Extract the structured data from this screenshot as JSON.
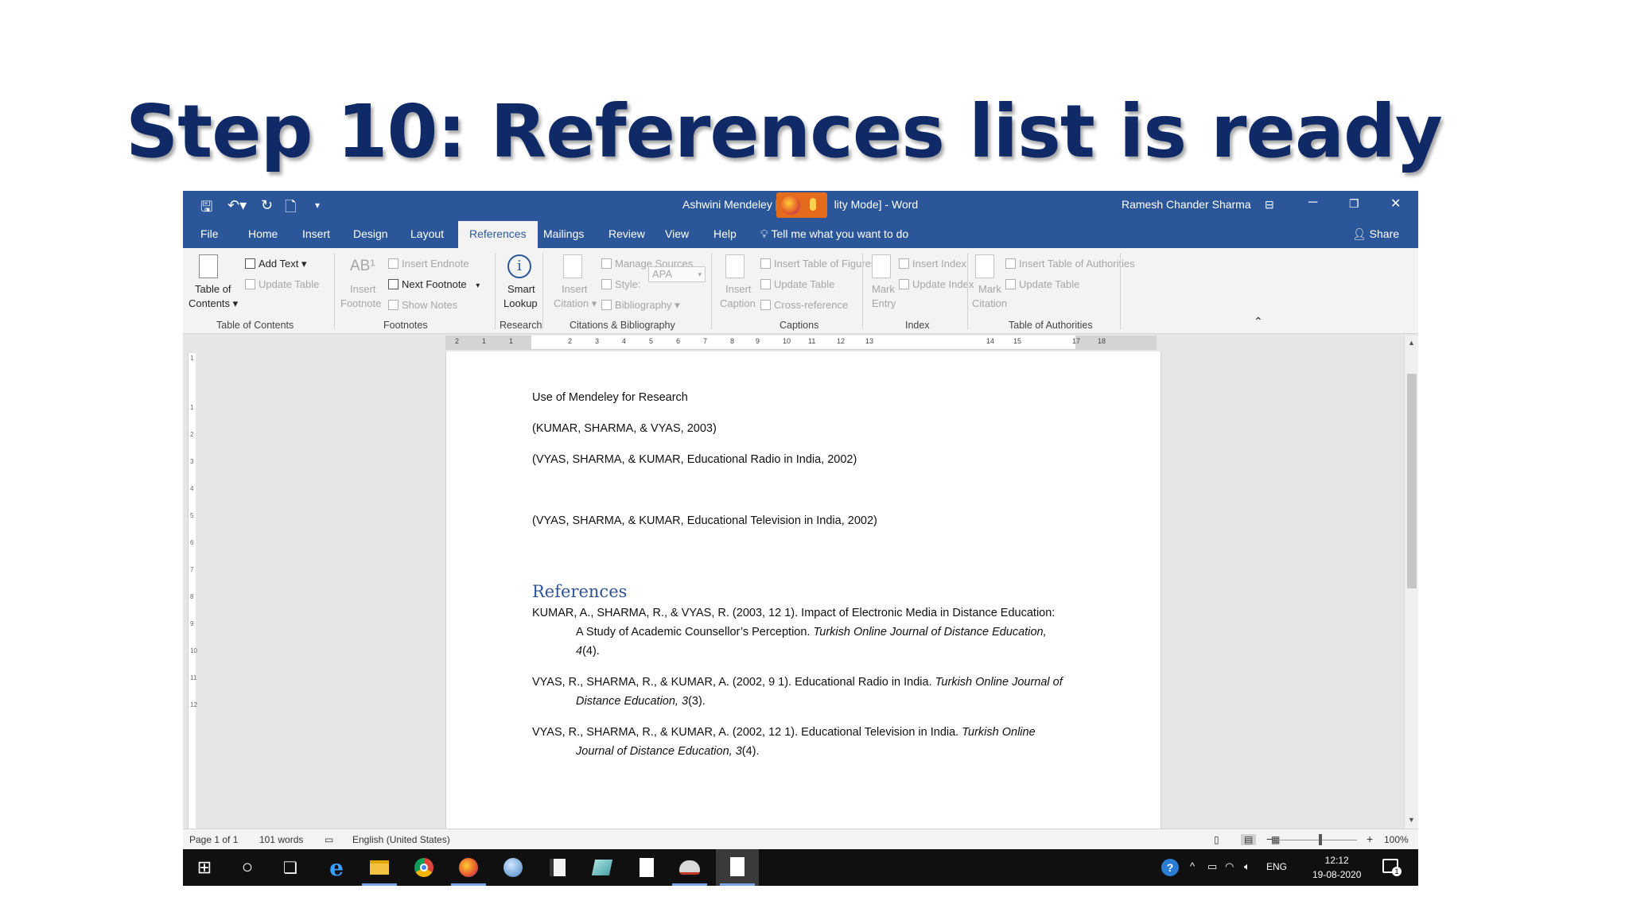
{
  "slide": {
    "title": "Step 10: References list is ready"
  },
  "window": {
    "doc_title": "Ashwini Mendeley [",
    "doc_title_suffix": "lity Mode]  -  Word",
    "user": "Ramesh Chander Sharma",
    "minimize": "─",
    "restore": "❐",
    "close": "✕",
    "ribbon_display": "⊟"
  },
  "quick_access": {
    "save": "🖫",
    "undo": "↶▾",
    "redo": "↻",
    "new_doc": "🗋",
    "customize": "▾"
  },
  "tabs": [
    "File",
    "Home",
    "Insert",
    "Design",
    "Layout",
    "References",
    "Mailings",
    "Review",
    "View",
    "Help"
  ],
  "tell_me": "Tell me what you want to do",
  "share": "Share",
  "ribbon": {
    "toc": {
      "label1": "Table of",
      "label2": "Contents ▾",
      "add_text": "Add Text ▾",
      "update_table": "Update Table",
      "group": "Table of Contents"
    },
    "footnotes": {
      "insert_label1": "Insert",
      "insert_label2": "Footnote",
      "insert_endnote": "Insert Endnote",
      "next_footnote": "Next Footnote",
      "next_footnote_arrow": "▾",
      "show_notes": "Show Notes",
      "group": "Footnotes",
      "icon_text": "AB¹"
    },
    "research": {
      "label1": "Smart",
      "label2": "Lookup",
      "group": "Research"
    },
    "citations": {
      "label1": "Insert",
      "label2": "Citation ▾",
      "manage_sources": "Manage Sources",
      "style_label": "Style:",
      "style_value": "APA",
      "bibliography": "Bibliography ▾",
      "group": "Citations & Bibliography"
    },
    "captions": {
      "label1": "Insert",
      "label2": "Caption",
      "insert_tof": "Insert Table of Figures",
      "update_table": "Update Table",
      "cross_reference": "Cross-reference",
      "group": "Captions"
    },
    "index": {
      "label1": "Mark",
      "label2": "Entry",
      "insert_index": "Insert Index",
      "update_index": "Update Index",
      "group": "Index"
    },
    "authorities": {
      "label1": "Mark",
      "label2": "Citation",
      "insert_toa": "Insert Table of Authorities",
      "update_table": "Update Table",
      "group": "Table of Authorities"
    },
    "collapse": "⌃"
  },
  "ruler": {
    "corner": "L",
    "h_numbers": [
      "2",
      "1",
      "1",
      "2",
      "3",
      "4",
      "5",
      "6",
      "7",
      "8",
      "9",
      "10",
      "11",
      "12",
      "13",
      "14",
      "15",
      "17",
      "18"
    ],
    "v_numbers": [
      "1",
      "1",
      "2",
      "3",
      "4",
      "5",
      "6",
      "7",
      "8",
      "9",
      "10",
      "11",
      "12"
    ]
  },
  "document": {
    "lines": [
      "Use of Mendeley for Research",
      "(KUMAR, SHARMA, & VYAS, 2003)",
      "(VYAS, SHARMA, & KUMAR, Educational Radio in India, 2002)",
      "(VYAS, SHARMA, & KUMAR, Educational Television in India, 2002)"
    ],
    "references_heading": "References",
    "refs": [
      {
        "a": "KUMAR, A., SHARMA, R., & VYAS, R. (2003, 12 1). Impact of Electronic Media in Distance Education:",
        "b": "A Study of Academic Counsellor’s Perception. ",
        "b_it": "Turkish Online Journal of Distance Education,",
        "c_it": "4",
        "c": "(4)."
      },
      {
        "a": "VYAS, R., SHARMA, R., & KUMAR, A. (2002, 9 1). Educational Radio in India. ",
        "a_it": "Turkish Online Journal of",
        "b_it": "Distance Education, 3",
        "b": "(3)."
      },
      {
        "a": "VYAS, R., SHARMA, R., & KUMAR, A. (2002, 12 1). Educational Television in India. ",
        "a_it": "Turkish Online",
        "b_it": "Journal of Distance Education, 3",
        "b": "(4)."
      }
    ]
  },
  "status": {
    "page": "Page 1 of 1",
    "words": "101 words",
    "language": "English (United States)",
    "zoom": "100%",
    "zoom_minus": "−",
    "zoom_plus": "+"
  },
  "taskbar": {
    "windows": "⊞",
    "search": "○",
    "task_view": "❏",
    "edge": "e",
    "tray_help": "?",
    "tray_up": "^",
    "lang": "ENG",
    "time": "12:12",
    "date": "19-08-2020",
    "notif": "1"
  },
  "colors": {
    "word_blue": "#2b579a",
    "title_navy": "#0f2a66",
    "heading_blue": "#2f5496"
  }
}
